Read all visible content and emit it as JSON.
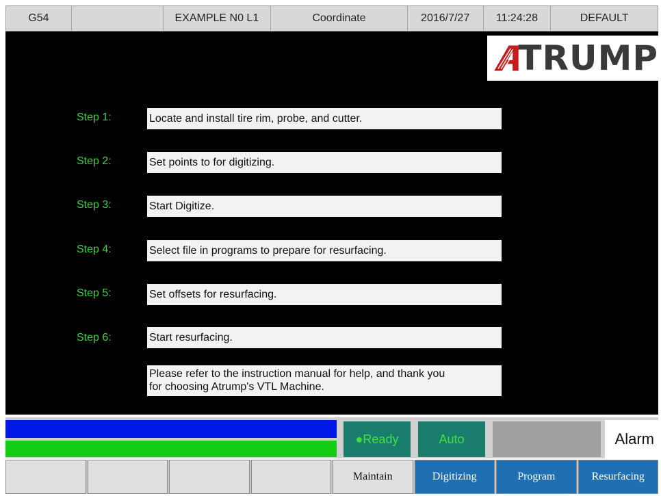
{
  "header": {
    "cells": [
      "G54",
      "",
      "EXAMPLE N0 L1",
      "Coordinate",
      "2016/7/27",
      "11:24:28",
      "DEFAULT"
    ]
  },
  "logo": {
    "text": "TRUMP",
    "icon": "atrump-logo-icon"
  },
  "steps": [
    {
      "label": "Step 1:",
      "text": "Locate and install tire rim, probe, and cutter."
    },
    {
      "label": "Step 2:",
      "text": "Set points to for digitizing."
    },
    {
      "label": "Step 3:",
      "text": "Start Digitize."
    },
    {
      "label": "Step 4:",
      "text": "Select file in programs to prepare for resurfacing."
    },
    {
      "label": "Step 5:",
      "text": "Set offsets for resurfacing."
    },
    {
      "label": "Step 6:",
      "text": "Start resurfacing."
    }
  ],
  "note": "Please refer to the instruction manual for help, and thank you\nfor choosing Atrump's VTL Machine.",
  "status": {
    "ready": "●Ready",
    "mode": "Auto",
    "alarm": "Alarm",
    "colors": {
      "progress_blue": "#0018e6",
      "progress_green": "#14cc14",
      "indicator_bg": "#1a7c6c",
      "indicator_text": "#3ee23e"
    }
  },
  "buttons": [
    "",
    "",
    "",
    "",
    "Maintain",
    "Digitizing",
    "Program",
    "Resurfacing"
  ],
  "colors": {
    "step_label": "#3ed43e",
    "panel_bg": "#000000",
    "button_active": "#1e6fb4"
  }
}
